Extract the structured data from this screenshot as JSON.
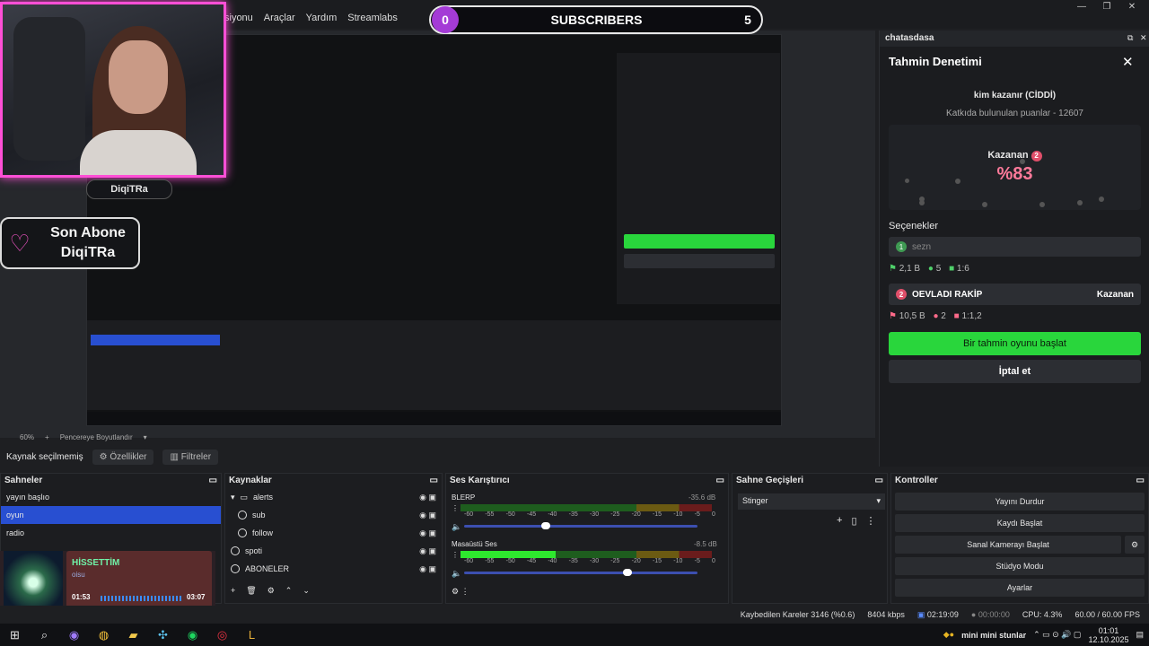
{
  "menu": [
    "siyonu",
    "Araçlar",
    "Yardım",
    "Streamlabs"
  ],
  "subscribers": {
    "count_left": "0",
    "label": "SUBSCRIBERS",
    "count_right": "5"
  },
  "webcam": {
    "name": "DiqiTRa"
  },
  "son_abone": {
    "line1": "Son Abone",
    "line2": "DiqiTRa"
  },
  "right_panel": {
    "header": "chatasdasa",
    "title": "Tahmin Denetimi",
    "question": "kim kazanır (CİDDİ)",
    "points": "Katkıda bulunulan puanlar - 12607",
    "winner_label": "Kazanan",
    "winner_num": "2",
    "winner_pct": "%83",
    "options_label": "Seçenekler",
    "option1": {
      "num": "1",
      "name": "sezn",
      "points": "2,1 B",
      "users": "5",
      "ratio": "1:6"
    },
    "option2": {
      "num": "2",
      "name": "OEVLADI RAKİP",
      "tag": "Kazanan",
      "points": "10,5 B",
      "users": "2",
      "ratio": "1:1,2"
    },
    "start_button": "Bir tahmin oyunu başlat",
    "cancel_button": "İptal et"
  },
  "zoom": {
    "level": "60%",
    "fit": "Pencereye Boyutlandır"
  },
  "propbar": {
    "nosel": "Kaynak seçilmemiş",
    "props": "Özellikler",
    "filters": "Filtreler"
  },
  "scenes": {
    "title": "Sahneler",
    "items": [
      "yayın başlıo",
      "oyun",
      "radio"
    ],
    "selected": 1
  },
  "sources": {
    "title": "Kaynaklar",
    "items": [
      "alerts",
      "sub",
      "follow",
      "spoti",
      "ABONELER"
    ]
  },
  "mixer": {
    "title": "Ses Karıştırıcı",
    "ch1": {
      "name": "BLERP",
      "db": "-35.6 dB",
      "level_pct": 0,
      "volume": 0.35
    },
    "ch2": {
      "name": "Masaüstü Ses",
      "db": "-8.5 dB",
      "level_pct": 0.38,
      "volume": 0.7
    },
    "ticks": [
      "-60",
      "-55",
      "-50",
      "-45",
      "-40",
      "-35",
      "-30",
      "-25",
      "-20",
      "-15",
      "-10",
      "-5",
      "0"
    ]
  },
  "transitions": {
    "title": "Sahne Geçişleri",
    "value": "Stinger"
  },
  "controls": {
    "title": "Kontroller",
    "buttons": [
      "Yayını Durdur",
      "Kaydı Başlat",
      "Sanal Kamerayı Başlat",
      "Stüdyo Modu",
      "Ayarlar"
    ]
  },
  "media": {
    "title": "HİSSETTİM",
    "artist": "oisu",
    "elapsed": "01:53",
    "total": "03:07"
  },
  "status": {
    "dropped": "Kaybedilen Kareler 3146 (%0.6)",
    "kbps": "8404 kbps",
    "live": "02:19:09",
    "rec": "00:00:00",
    "cpu": "CPU: 4.3%",
    "fps": "60.00 / 60.00 FPS"
  },
  "taskbar": {
    "time": "01:01",
    "date": "12.10.2025",
    "tray_text": "mini mini stunlar"
  },
  "colors": {
    "accent_green": "#29d63c",
    "selection_blue": "#284fd1",
    "webcam_border": "#ff4fd6",
    "winner_pink": "#ff7a9a"
  }
}
